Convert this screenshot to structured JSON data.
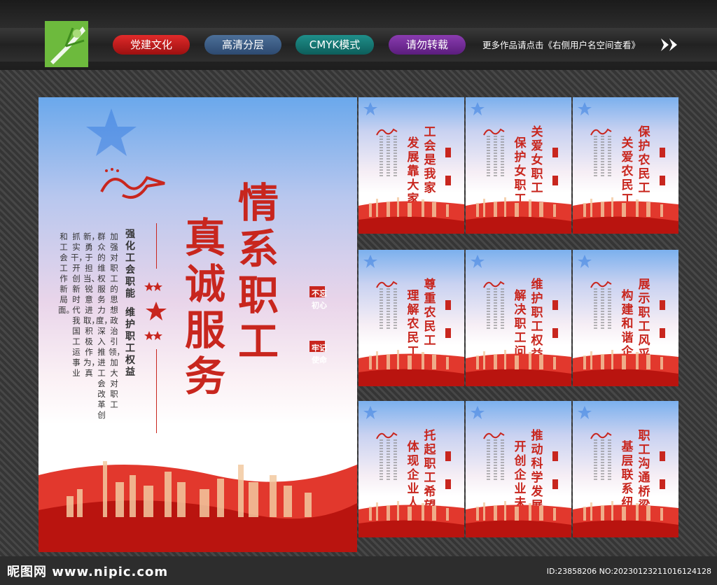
{
  "header": {
    "pills": [
      "党建文化",
      "高清分层",
      "CMYK模式",
      "请勿转载"
    ],
    "more_text": "更多作品请点击《右侧用户名空间查看》"
  },
  "main_poster": {
    "title_line1": "情系职工",
    "title_line2": "真诚服务",
    "subtitle_a": "强化工会职能",
    "subtitle_b": "维护职工权益",
    "body_cols": [
      "加强对职工的思想政治引领，加大对职工",
      "群众的维权服务力度，深入推进工会改革创",
      "新，勇于担当、锐意进取，积极作为，真",
      "抓实干，开创新时代我国工运事业",
      "和工会工作新局面。"
    ],
    "mission_1": "不忘初心",
    "mission_2": "牢记使命"
  },
  "cards": [
    {
      "line1": "工会是我家",
      "line2": "发展靠大家"
    },
    {
      "line1": "关爱女职工",
      "line2": "保护女职工"
    },
    {
      "line1": "保护农民工",
      "line2": "关爱农民工"
    },
    {
      "line1": "尊重农民工",
      "line2": "理解农民工"
    },
    {
      "line1": "维护职工权益",
      "line2": "解决职工问题"
    },
    {
      "line1": "展示职工风采",
      "line2": "构建和谐企业"
    },
    {
      "line1": "托起职工希望",
      "line2": "体现企业人文"
    },
    {
      "line1": "推动科学发展",
      "line2": "开创企业未来"
    },
    {
      "line1": "职工沟通桥梁",
      "line2": "基层联系纽带"
    }
  ],
  "footer": {
    "site": "昵图网 www.nipic.com",
    "id_text": "ID:23858206 NO:20230123211016124128"
  },
  "colors": {
    "accent_red": "#c8261e",
    "logo_green": "#6dba3d"
  }
}
